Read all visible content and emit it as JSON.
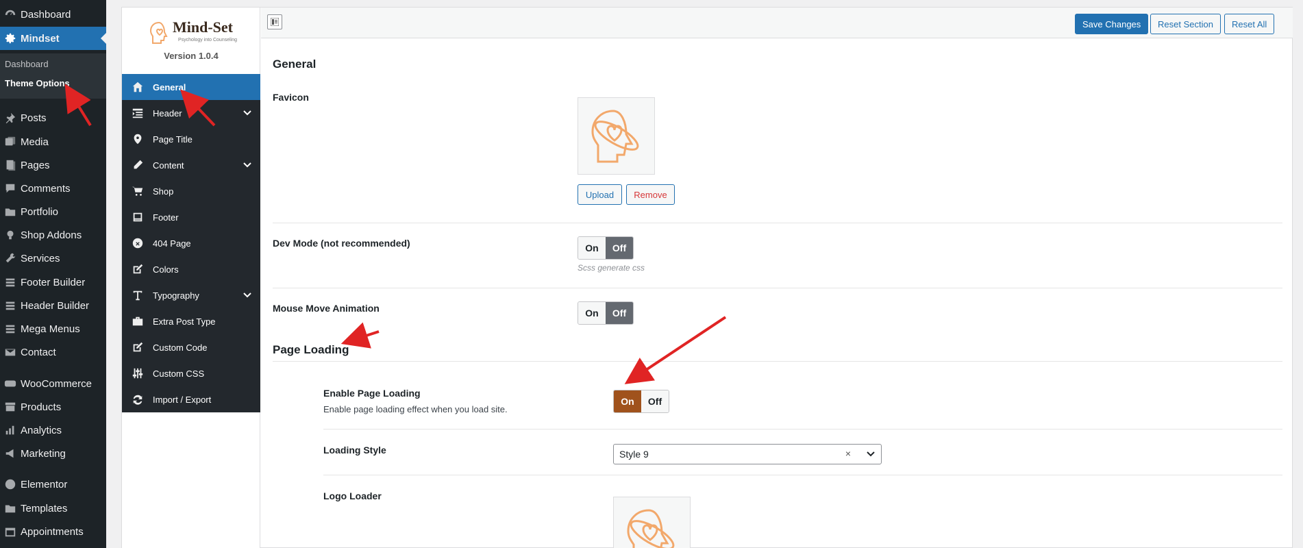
{
  "wp_menu": {
    "items": [
      {
        "label": "Dashboard",
        "icon": "dashboard-icon"
      },
      {
        "label": "Mindset",
        "icon": "gear-icon",
        "active": true
      },
      {
        "label": "Posts",
        "icon": "pin-icon"
      },
      {
        "label": "Media",
        "icon": "media-icon"
      },
      {
        "label": "Pages",
        "icon": "pages-icon"
      },
      {
        "label": "Comments",
        "icon": "comment-icon"
      },
      {
        "label": "Portfolio",
        "icon": "folder-icon"
      },
      {
        "label": "Shop Addons",
        "icon": "bulb-icon"
      },
      {
        "label": "Services",
        "icon": "wrench-icon"
      },
      {
        "label": "Footer Builder",
        "icon": "list-icon"
      },
      {
        "label": "Header Builder",
        "icon": "list-icon"
      },
      {
        "label": "Mega Menus",
        "icon": "list-icon"
      },
      {
        "label": "Contact",
        "icon": "mail-icon"
      },
      {
        "label": "WooCommerce",
        "icon": "woo-icon"
      },
      {
        "label": "Products",
        "icon": "archive-icon"
      },
      {
        "label": "Analytics",
        "icon": "bar-chart-icon"
      },
      {
        "label": "Marketing",
        "icon": "megaphone-icon"
      },
      {
        "label": "Elementor",
        "icon": "elementor-icon"
      },
      {
        "label": "Templates",
        "icon": "folder-icon"
      },
      {
        "label": "Appointments",
        "icon": "calendar-icon"
      }
    ],
    "submenu": {
      "dashboard": "Dashboard",
      "theme_options": "Theme Options"
    }
  },
  "options_nav": {
    "brand": "Mind-Set",
    "tagline": "Psychology into Counseling",
    "version": "Version 1.0.4",
    "items": [
      {
        "label": "General",
        "icon": "home-icon",
        "active": true
      },
      {
        "label": "Header",
        "icon": "header-icon",
        "expandable": true
      },
      {
        "label": "Page Title",
        "icon": "location-pin-icon"
      },
      {
        "label": "Content",
        "icon": "pencil-icon",
        "expandable": true
      },
      {
        "label": "Shop",
        "icon": "cart-icon"
      },
      {
        "label": "Footer",
        "icon": "footer-icon"
      },
      {
        "label": "404 Page",
        "icon": "error-icon"
      },
      {
        "label": "Colors",
        "icon": "edit-icon"
      },
      {
        "label": "Typography",
        "icon": "typography-icon",
        "expandable": true
      },
      {
        "label": "Extra Post Type",
        "icon": "briefcase-icon"
      },
      {
        "label": "Custom Code",
        "icon": "code-icon"
      },
      {
        "label": "Custom CSS",
        "icon": "sliders-icon"
      },
      {
        "label": "Import / Export",
        "icon": "refresh-icon"
      }
    ]
  },
  "toolbar": {
    "save_label": "Save Changes",
    "reset_section_label": "Reset Section",
    "reset_all_label": "Reset All"
  },
  "content": {
    "section_general": "General",
    "favicon_label": "Favicon",
    "upload_label": "Upload",
    "remove_label": "Remove",
    "dev_mode_label": "Dev Mode (not recommended)",
    "dev_mode_hint": "Scss generate css",
    "mouse_move_label": "Mouse Move Animation",
    "section_page_loading": "Page Loading",
    "enable_loading_label": "Enable Page Loading",
    "enable_loading_desc": "Enable page loading effect when you load site.",
    "loading_style_label": "Loading Style",
    "loading_style_value": "Style 9",
    "logo_loader_label": "Logo Loader",
    "on_label": "On",
    "off_label": "Off",
    "clear_symbol": "×"
  },
  "colors": {
    "wp_sidebar": "#1d2327",
    "accent_blue": "#2271b1",
    "toggle_on": "#a0521c",
    "toggle_off": "#646970",
    "logo_orange": "#f2a86b",
    "annotation_red": "#e02424"
  }
}
